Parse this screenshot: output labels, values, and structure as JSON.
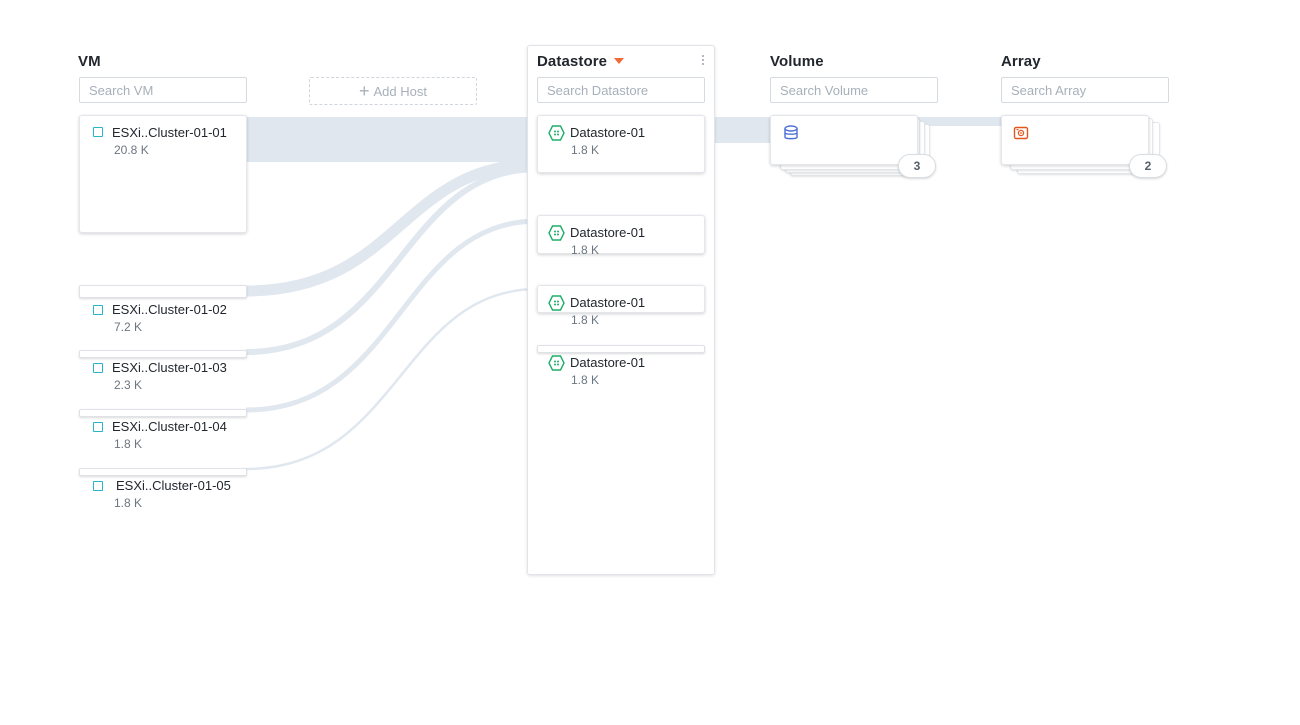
{
  "columns": {
    "vm": {
      "title": "VM",
      "search_placeholder": "Search VM"
    },
    "datastore": {
      "title": "Datastore",
      "search_placeholder": "Search Datastore"
    },
    "volume": {
      "title": "Volume",
      "search_placeholder": "Search Volume",
      "count": "3"
    },
    "array": {
      "title": "Array",
      "search_placeholder": "Search Array",
      "count": "2"
    }
  },
  "add_host_label": "Add Host",
  "vm_items": [
    {
      "name": "ESXi..Cluster-01-01",
      "value": "20.8 K"
    },
    {
      "name": "ESXi..Cluster-01-02",
      "value": "7.2 K"
    },
    {
      "name": "ESXi..Cluster-01-03",
      "value": "2.3 K"
    },
    {
      "name": "ESXi..Cluster-01-04",
      "value": "1.8 K"
    },
    {
      "name": "ESXi..Cluster-01-05",
      "value": "1.8 K"
    }
  ],
  "datastore_items": [
    {
      "name": "Datastore-01",
      "value": "1.8 K"
    },
    {
      "name": "Datastore-01",
      "value": "1.8 K"
    },
    {
      "name": "Datastore-01",
      "value": "1.8 K"
    },
    {
      "name": "Datastore-01",
      "value": "1.8 K"
    }
  ],
  "colors": {
    "flow": "#e0e7ef",
    "checkbox": "#26b5c9",
    "datastore_icon": "#1fae6a",
    "volume_icon": "#4a6ed6",
    "array_icon": "#e2571e",
    "sort_caret": "#f06a35"
  },
  "icons": {
    "datastore": "hexagon-datastore-icon",
    "volume": "database-icon",
    "array": "array-storage-icon",
    "vm": "checkbox-icon"
  }
}
